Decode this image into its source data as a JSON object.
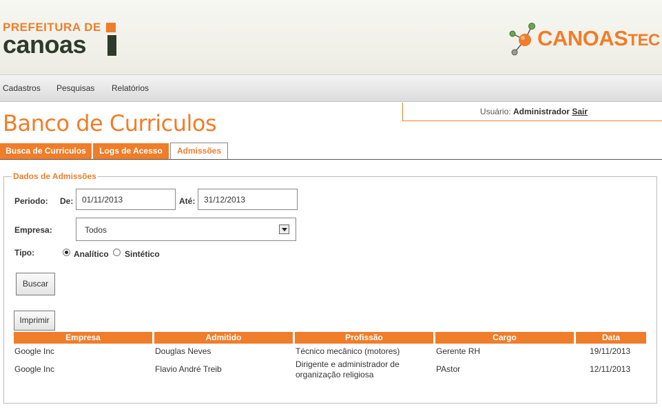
{
  "header": {
    "logo_left_line1": "PREFEITURA DE",
    "logo_left_line2": "canoas",
    "logo_right_main": "CANOAS",
    "logo_right_suffix": "TEC"
  },
  "menu": {
    "items": [
      "Cadastros",
      "Pesquisas",
      "Relatórios"
    ]
  },
  "user": {
    "label": "Usuário:",
    "name": "Administrador",
    "logout": "Sair"
  },
  "page_title": "Banco de Curriculos",
  "tabs": [
    {
      "label": "Busca de Curriculos",
      "active": false
    },
    {
      "label": "Logs de Acesso",
      "active": false
    },
    {
      "label": "Admissões",
      "active": true
    }
  ],
  "form": {
    "legend": "Dados de Admissões",
    "periodo_label": "Periodo:",
    "de_label": "De:",
    "de_value": "01/11/2013",
    "ate_label": "Até:",
    "ate_value": "31/12/2013",
    "empresa_label": "Empresa:",
    "empresa_value": "Todos",
    "tipo_label": "Tipo:",
    "tipo_options": [
      "Analítico",
      "Sintético"
    ],
    "tipo_selected": "Analítico",
    "buscar_label": "Buscar",
    "imprimir_label": "Imprimir"
  },
  "table": {
    "headers": [
      "Empresa",
      "Admitido",
      "Profissão",
      "Cargo",
      "Data"
    ],
    "rows": [
      {
        "empresa": "Google Inc",
        "admitido": "Douglas Neves",
        "profissao": "Técnico mecânico (motores)",
        "profissao2": "",
        "cargo": "Gerente RH",
        "data": "19/11/2013"
      },
      {
        "empresa": "Google Inc",
        "admitido": "Flavio André Treib",
        "profissao": "Dirigente e administrador de",
        "profissao2": "organização religiosa",
        "cargo": "PAstor",
        "data": "12/11/2013"
      }
    ]
  },
  "colors": {
    "accent": "#ef7d2a",
    "dark_green": "#2e3a2a"
  }
}
